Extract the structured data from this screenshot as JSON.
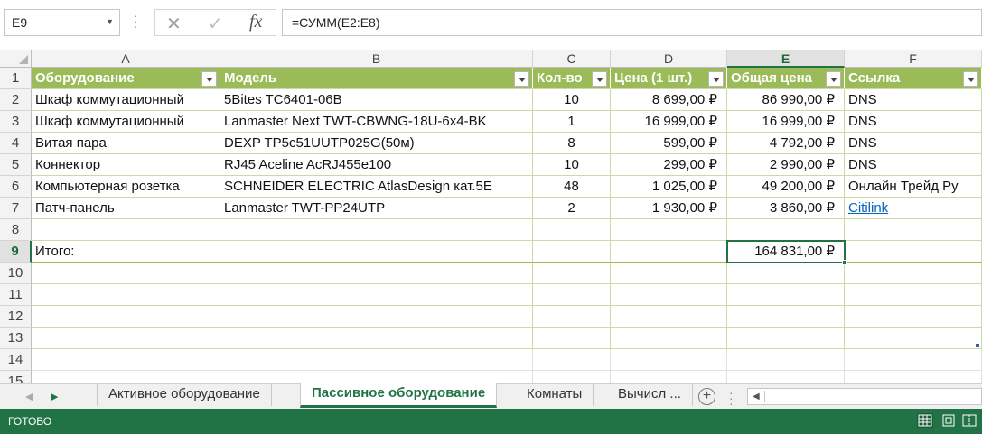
{
  "formula_bar": {
    "name_box": "E9",
    "cancel_glyph": "✕",
    "enter_glyph": "✓",
    "fx_label": "fx",
    "formula": "=СУММ(E2:E8)"
  },
  "columns": [
    "A",
    "B",
    "C",
    "D",
    "E",
    "F"
  ],
  "selected_column": "E",
  "rows": [
    "1",
    "2",
    "3",
    "4",
    "5",
    "6",
    "7",
    "8",
    "9",
    "10",
    "11",
    "12",
    "13",
    "14",
    "15"
  ],
  "selected_row": "9",
  "table": {
    "headers": [
      "Оборудование",
      "Модель",
      "Кол-во",
      "Цена (1 шт.)",
      "Общая цена",
      "Ссылка"
    ],
    "rows": [
      [
        "Шкаф коммутационный",
        "5Bites TC6401-06B",
        "10",
        "8 699,00 ₽",
        "86 990,00 ₽",
        "DNS"
      ],
      [
        "Шкаф коммутационный",
        "Lanmaster Next TWT-CBWNG-18U-6x4-BK",
        "1",
        "16 999,00 ₽",
        "16 999,00 ₽",
        "DNS"
      ],
      [
        "Витая пара",
        "DEXP TP5c51UUTP025G(50м)",
        "8",
        "599,00 ₽",
        "4 792,00 ₽",
        "DNS"
      ],
      [
        "Коннектор",
        "RJ45 Aceline AcRJ455e100",
        "10",
        "299,00 ₽",
        "2 990,00 ₽",
        "DNS"
      ],
      [
        "Компьютерная розетка",
        "SCHNEIDER ELECTRIC AtlasDesign кат.5E",
        "48",
        "1 025,00 ₽",
        "49 200,00 ₽",
        "Онлайн Трейд Ру"
      ],
      [
        "Патч-панель",
        "Lanmaster TWT-PP24UTP",
        "2",
        "1 930,00 ₽",
        "3 860,00 ₽",
        "Citilink"
      ]
    ],
    "link_row_index": 5
  },
  "total": {
    "label": "Итого:",
    "value": "164 831,00 ₽"
  },
  "sheet_tabs": [
    {
      "label": "Активное оборудование",
      "active": false
    },
    {
      "label": "Пассивное оборудование",
      "active": true
    },
    {
      "label": "Комнаты",
      "active": false
    },
    {
      "label": "Вычисл ...",
      "active": false
    }
  ],
  "add_sheet_glyph": "+",
  "status": {
    "ready_text": "ГОТОВО"
  },
  "colors": {
    "header_green": "#9bbb59",
    "excel_green": "#217346",
    "link_blue": "#0563c1"
  }
}
